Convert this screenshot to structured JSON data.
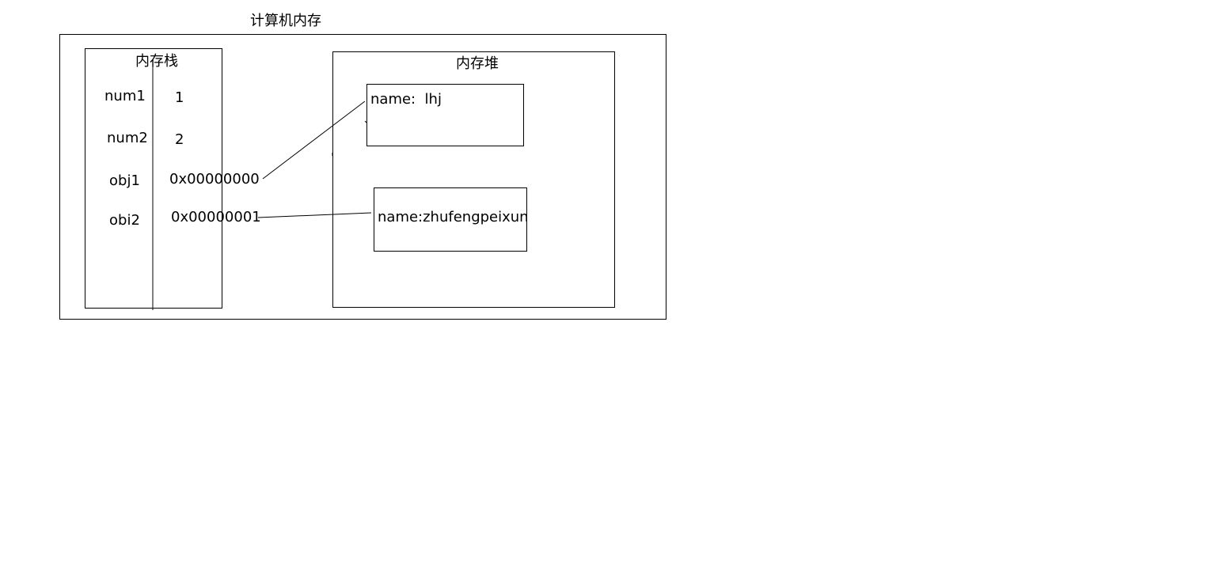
{
  "diagram": {
    "title": "计算机内存",
    "stack": {
      "title": "内存栈",
      "rows": [
        {
          "name": "num1",
          "value": "1"
        },
        {
          "name": "num2",
          "value": "2"
        },
        {
          "name": "obj1",
          "value": "0x00000000"
        },
        {
          "name": "obi2",
          "value": "0x00000001"
        }
      ]
    },
    "heap": {
      "title": "内存堆",
      "objects": [
        {
          "text": "name:  lhj"
        },
        {
          "text": "name:zhufengpeixun"
        }
      ]
    }
  }
}
